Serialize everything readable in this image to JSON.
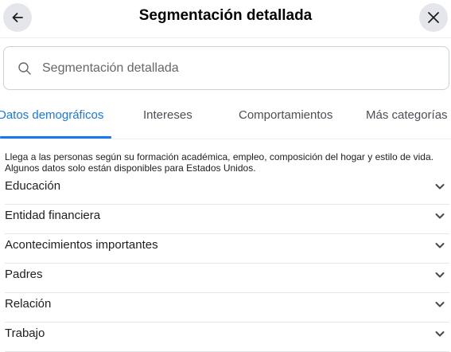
{
  "header": {
    "title": "Segmentación detallada",
    "back_icon": "arrow-left-icon",
    "close_icon": "close-x-icon"
  },
  "search": {
    "placeholder": "Segmentación detallada",
    "value": "",
    "icon": "search-icon"
  },
  "tabs": [
    {
      "label": "Datos demográficos",
      "active": true
    },
    {
      "label": "Intereses",
      "active": false
    },
    {
      "label": "Comportamientos",
      "active": false
    },
    {
      "label": "Más categorías",
      "active": false
    }
  ],
  "description": {
    "line1": "Llega a las personas según su formación académica, empleo, composición del hogar y estilo de vida.",
    "line2": "Algunos datos solo están disponibles para Estados Unidos."
  },
  "categories": [
    {
      "label": "Educación"
    },
    {
      "label": "Entidad financiera"
    },
    {
      "label": "Acontecimientos importantes"
    },
    {
      "label": "Padres"
    },
    {
      "label": "Relación"
    },
    {
      "label": "Trabajo"
    }
  ],
  "colors": {
    "accent": "#1877f2",
    "button_bg": "#e4e6eb",
    "text": "#1c1e21",
    "muted": "#65676b"
  }
}
